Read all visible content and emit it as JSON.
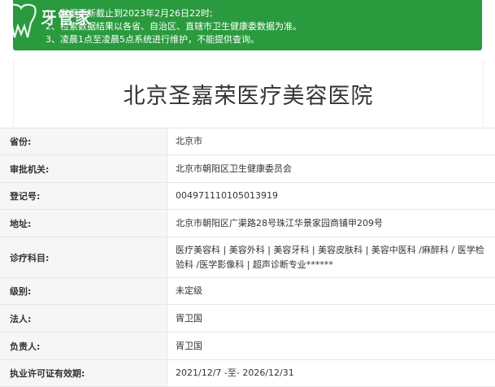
{
  "notice": {
    "lines": [
      "1、数据更新截止到2023年2月26日22时;",
      "2、检索数据结果以各省、自治区、直辖市卫生健康委数据为准。",
      "3、凌晨1点至凌晨5点系统进行维护，不能提供查询。"
    ],
    "watermark_text": "牙管家",
    "background_color": "#2a9a3e"
  },
  "hospital": {
    "name": "北京圣嘉荣医疗美容医院"
  },
  "rows": [
    {
      "label": "省份:",
      "value": "北京市"
    },
    {
      "label": "审批机关:",
      "value": "北京市朝阳区卫生健康委员会"
    },
    {
      "label": "登记号:",
      "value": "004971110105013919"
    },
    {
      "label": "地址:",
      "value": "北京市朝阳区广渠路28号珠江华景家园商铺甲209号"
    },
    {
      "label": "诊疗科目:",
      "value": "医疗美容科 | 美容外科 | 美容牙科 | 美容皮肤科 | 美容中医科 /麻醉科 / 医学检验科 /医学影像科 | 超声诊断专业******"
    },
    {
      "label": "级别:",
      "value": "未定级"
    },
    {
      "label": "法人:",
      "value": "胥卫国"
    },
    {
      "label": "负责人:",
      "value": "胥卫国"
    },
    {
      "label": "执业许可证有效期:",
      "value": "2021/12/7 -至- 2026/12/31"
    }
  ]
}
